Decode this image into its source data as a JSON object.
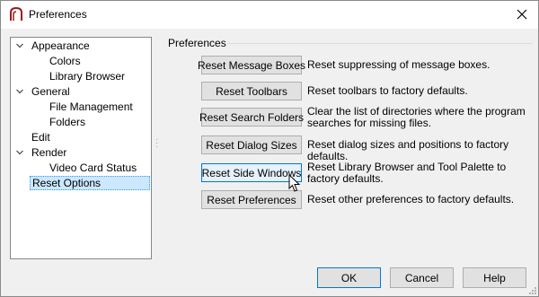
{
  "window": {
    "title": "Preferences",
    "close_icon": "close-icon",
    "app_icon": "chief-architect-logo-icon"
  },
  "tree": {
    "items": [
      {
        "label": "Appearance",
        "level": 0,
        "expanded": true
      },
      {
        "label": "Colors",
        "level": 1
      },
      {
        "label": "Library Browser",
        "level": 1
      },
      {
        "label": "General",
        "level": 0,
        "expanded": true
      },
      {
        "label": "File Management",
        "level": 1
      },
      {
        "label": "Folders",
        "level": 1
      },
      {
        "label": "Edit",
        "level": 0
      },
      {
        "label": "Render",
        "level": 0,
        "expanded": true
      },
      {
        "label": "Video Card Status",
        "level": 1
      },
      {
        "label": "Reset Options",
        "level": 0,
        "selected": true
      }
    ]
  },
  "panel": {
    "group_title": "Preferences",
    "rows": [
      {
        "button": "Reset Message Boxes",
        "description": "Reset suppressing of message boxes."
      },
      {
        "button": "Reset Toolbars",
        "description": "Reset toolbars to factory defaults."
      },
      {
        "button": "Reset Search Folders",
        "description": "Clear the list of directories where the program searches for missing files."
      },
      {
        "button": "Reset Dialog Sizes",
        "description": "Reset dialog sizes and positions to factory defaults."
      },
      {
        "button": "Reset Side Windows",
        "description": "Reset Library Browser and Tool Palette to factory defaults."
      },
      {
        "button": "Reset Preferences",
        "description": "Reset other preferences to factory defaults."
      }
    ]
  },
  "footer": {
    "ok": "OK",
    "cancel": "Cancel",
    "help": "Help"
  },
  "colors": {
    "selection": "#cce8ff",
    "focus_border": "#0078d7"
  }
}
